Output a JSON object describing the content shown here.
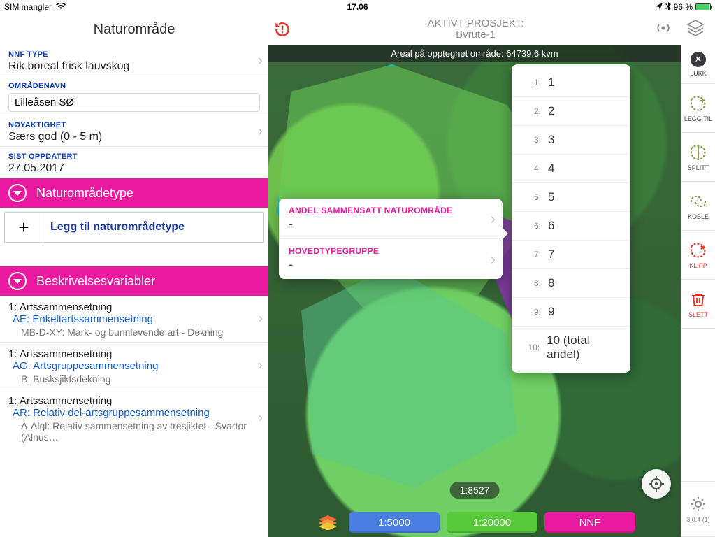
{
  "status": {
    "carrier": "SIM mangler",
    "time": "17.06",
    "battery": "96 %"
  },
  "leftTitle": "Naturområde",
  "nnf": {
    "label": "NNF TYPE",
    "value": "Rik boreal frisk lauvskog"
  },
  "omrade": {
    "label": "OMRÅDENAVN",
    "value": "Lilleåsen SØ"
  },
  "noyaktighet": {
    "label": "NØYAKTIGHET",
    "value": "Særs god (0 - 5 m)"
  },
  "sist": {
    "label": "SIST OPPDATERT",
    "value": "27.05.2017"
  },
  "bars": {
    "type": "Naturområdetype",
    "besk": "Beskrivelsesvariabler"
  },
  "addRow": "Legg til naturområdetype",
  "vars": [
    {
      "l1": "1: Artssammensetning",
      "l2": "AE: Enkeltartssammensetning",
      "l3": "MB-D-XY: Mark- og bunnlevende art - Dekning"
    },
    {
      "l1": "1: Artssammensetning",
      "l2": "AG: Artsgruppesammensetning",
      "l3": "B: Busksjiktsdekning"
    },
    {
      "l1": "1: Artssammensetning",
      "l2": "AR: Relativ del-artsgruppesammensetning",
      "l3": "A-Algl: Relativ sammensetning av tresjiktet - Svartor (Alnus…"
    }
  ],
  "project": {
    "label": "AKTIVT PROSJEKT:",
    "name": "Bvrute-1"
  },
  "areaStrip": "Areal på opptegnet område: 64739.6 kvm",
  "popover": {
    "a": {
      "label": "ANDEL SAMMENSATT NATUROMRÅDE",
      "value": "-"
    },
    "b": {
      "label": "HOVEDTYPEGRUPPE",
      "value": "-"
    }
  },
  "numbers": [
    {
      "idx": "1:",
      "val": "1"
    },
    {
      "idx": "2:",
      "val": "2"
    },
    {
      "idx": "3:",
      "val": "3"
    },
    {
      "idx": "4:",
      "val": "4"
    },
    {
      "idx": "5:",
      "val": "5"
    },
    {
      "idx": "6:",
      "val": "6"
    },
    {
      "idx": "7:",
      "val": "7"
    },
    {
      "idx": "8:",
      "val": "8"
    },
    {
      "idx": "9:",
      "val": "9"
    },
    {
      "idx": "10:",
      "val": "10 (total andel)"
    }
  ],
  "scale": "1:8527",
  "buttons": {
    "b1": "1:5000",
    "b2": "1:20000",
    "b3": "NNF"
  },
  "tools": {
    "lukk": "LUKK",
    "leggtil": "LEGG TIL",
    "splitt": "SPLITT",
    "koble": "KOBLE",
    "klipp": "KLIPP",
    "slett": "SLETT"
  },
  "version": "3.0.4 (1)"
}
